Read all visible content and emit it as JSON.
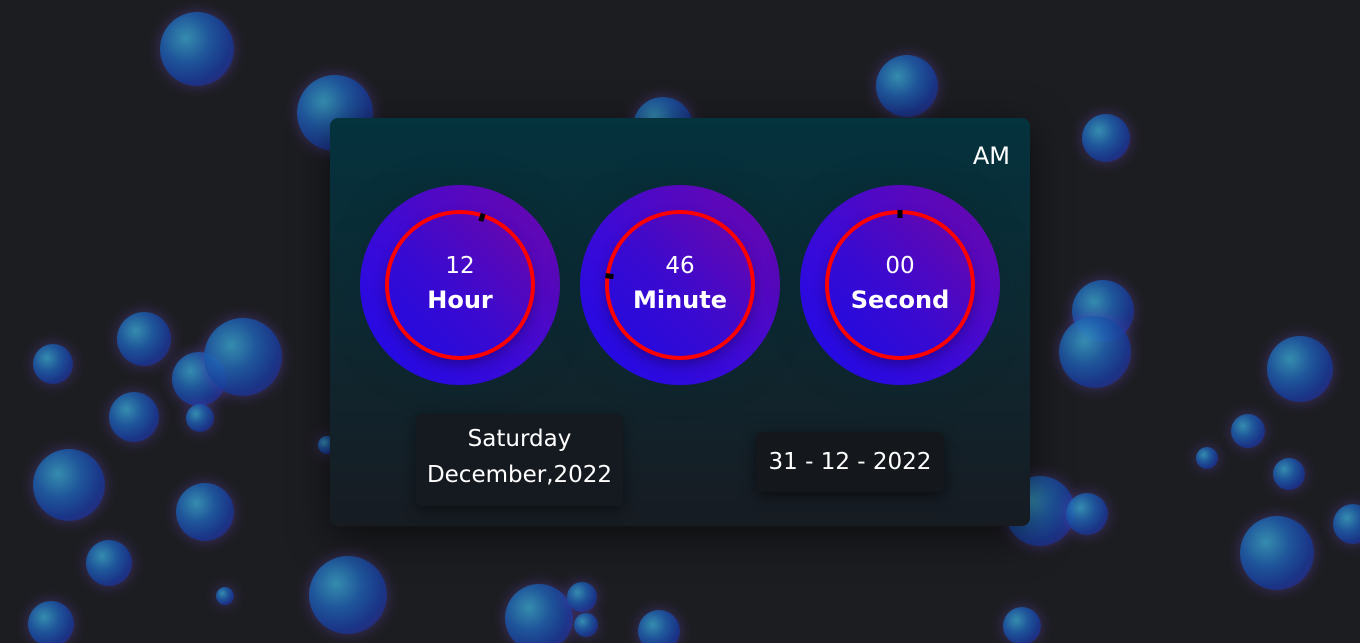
{
  "clock": {
    "meridiem": "AM",
    "hour": {
      "value": "12",
      "label": "Hour",
      "progress": 0.05
    },
    "minute": {
      "value": "46",
      "label": "Minute",
      "progress": 0.77
    },
    "second": {
      "value": "00",
      "label": "Second",
      "progress": 0.0
    }
  },
  "date": {
    "weekday": "Saturday",
    "month_year": "December,2022",
    "numeric": "31 - 12 - 2022"
  },
  "colors": {
    "background": "#1c1d21",
    "ring": "#ff0000",
    "indicator": "#000000",
    "dial_violet": "#6f06a8",
    "dial_blue": "#1c0ae8"
  },
  "decorations": {
    "bubble_icon": "bubble-icon"
  }
}
